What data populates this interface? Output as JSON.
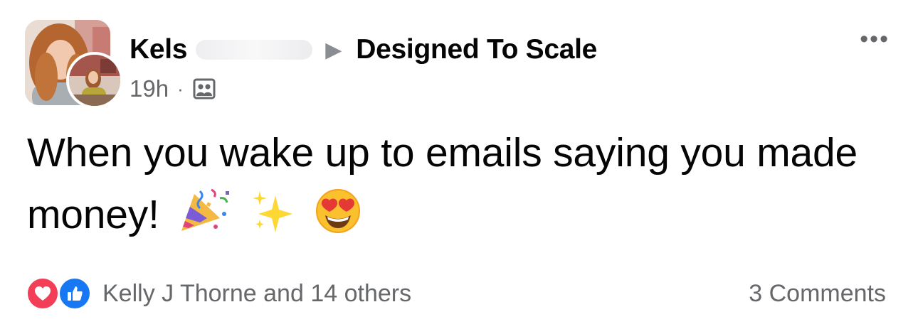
{
  "post": {
    "author_name": "Kels",
    "group_name": "Designed To Scale",
    "timestamp": "19h",
    "separator": "·",
    "audience_icon": "group-audience-icon",
    "more_icon": "more-options-icon",
    "more_glyph": "•••",
    "arrow_glyph": "▶",
    "text": "When you wake up to emails saying you made money!",
    "emojis": [
      "party-popper-emoji",
      "sparkles-emoji",
      "heart-eyes-emoji"
    ]
  },
  "footer": {
    "reactions_text": "Kelly J Thorne and 14 others",
    "reaction_icons": [
      "love-reaction-icon",
      "like-reaction-icon"
    ],
    "comments_text": "3 Comments"
  },
  "colors": {
    "love": "#f33e58",
    "like": "#1877f2",
    "secondary_text": "#65676b",
    "primary_text": "#050505"
  }
}
